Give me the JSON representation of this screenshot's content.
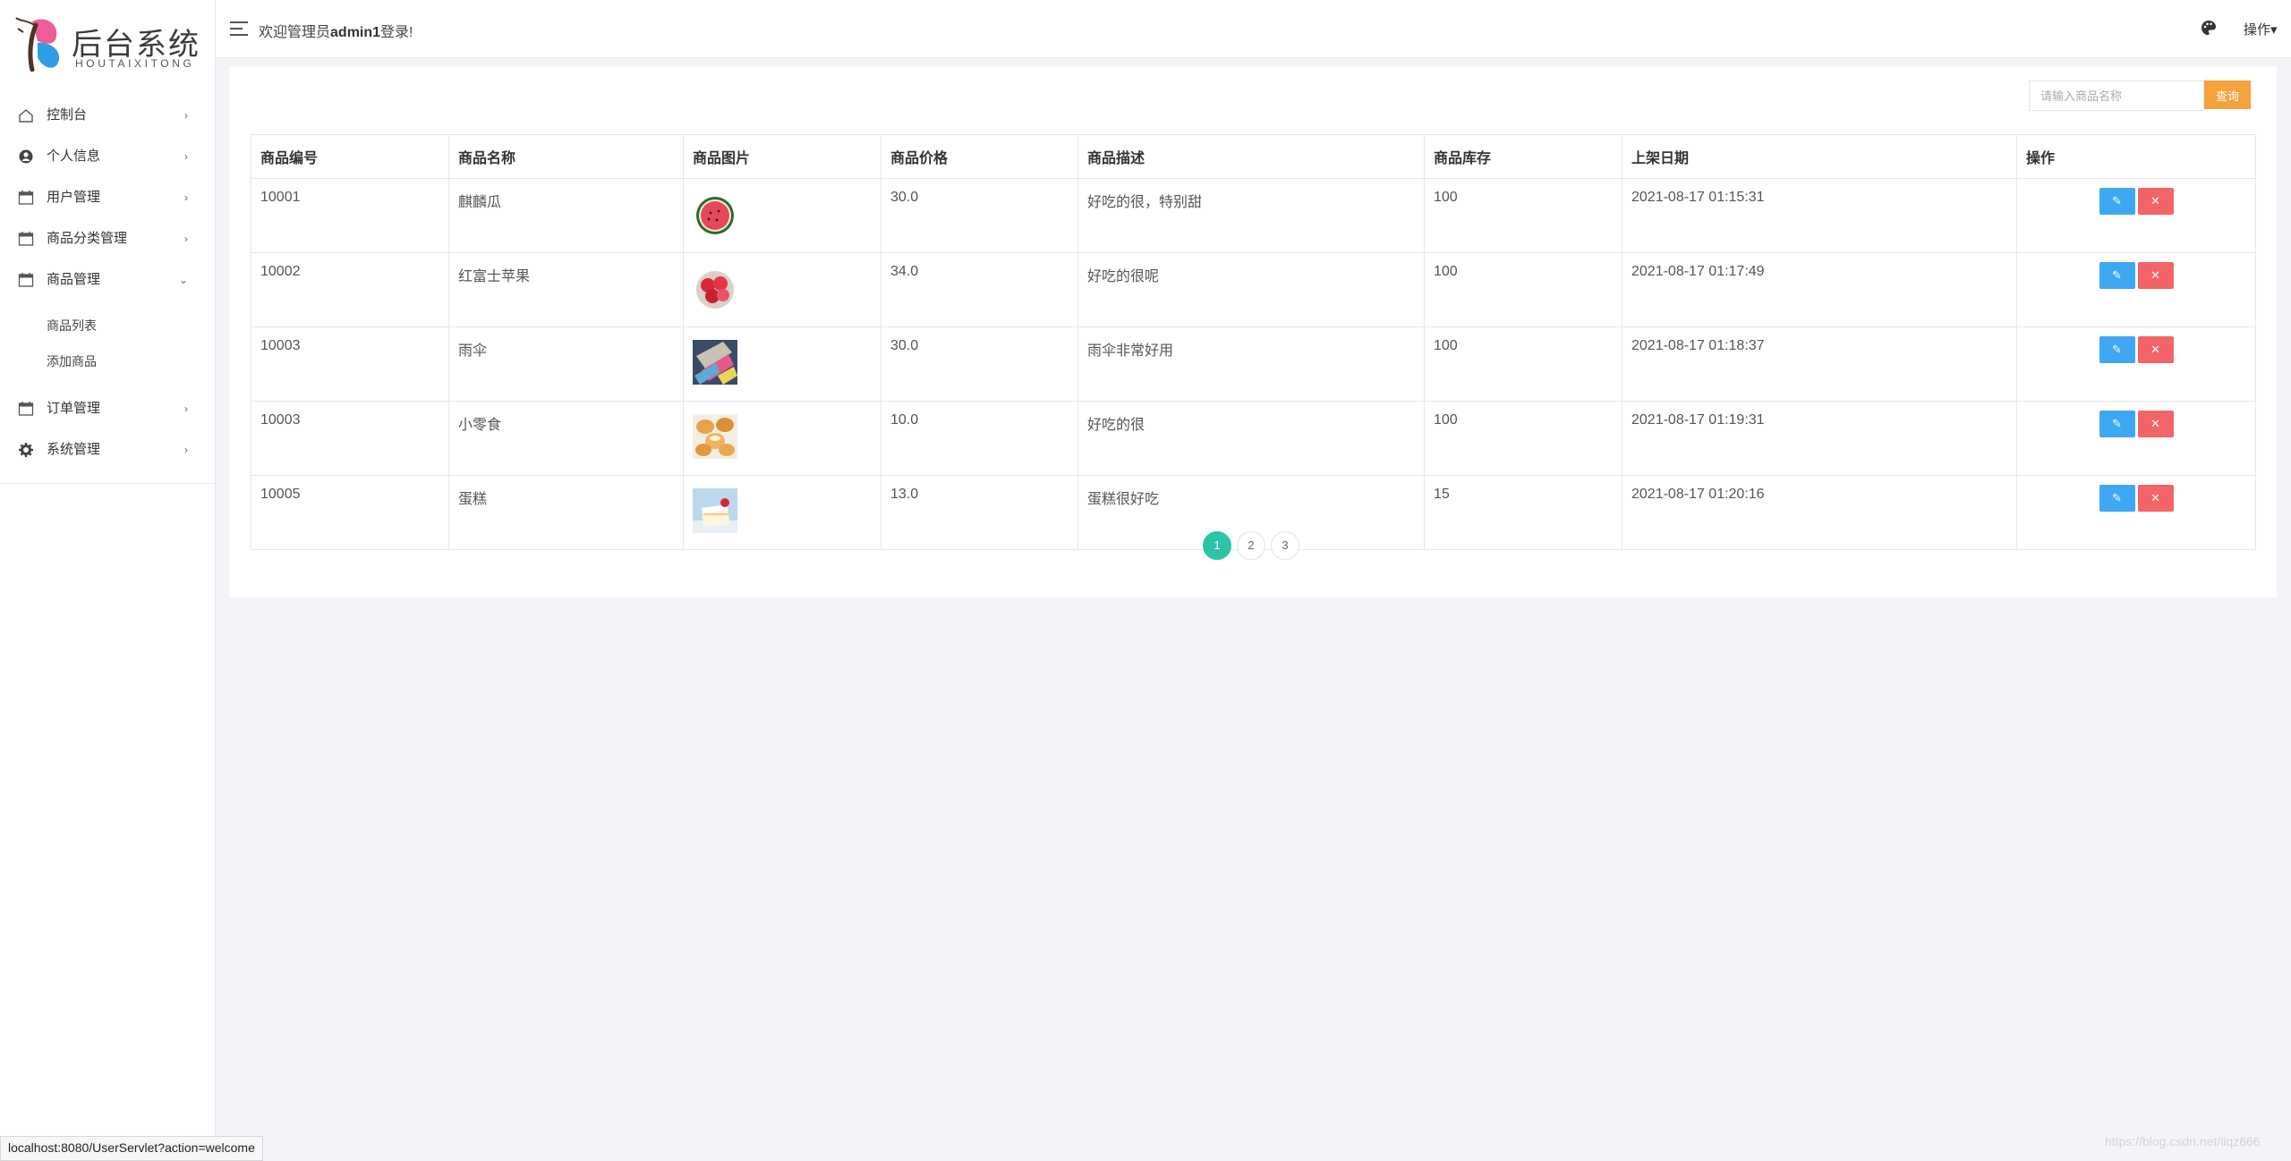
{
  "brand": {
    "title": "后台系统",
    "subtitle": "HOUTAIXITONG"
  },
  "sidebar": {
    "items": [
      {
        "label": "控制台",
        "icon": "home-icon",
        "arrow": "›"
      },
      {
        "label": "个人信息",
        "icon": "user-icon",
        "arrow": "›"
      },
      {
        "label": "用户管理",
        "icon": "calendar-icon",
        "arrow": "›"
      },
      {
        "label": "商品分类管理",
        "icon": "calendar-icon",
        "arrow": "›"
      },
      {
        "label": "商品管理",
        "icon": "calendar-icon",
        "arrow": "⌄",
        "expanded": true,
        "children": [
          {
            "label": "商品列表"
          },
          {
            "label": "添加商品"
          }
        ]
      },
      {
        "label": "订单管理",
        "icon": "calendar-icon",
        "arrow": "›"
      },
      {
        "label": "系统管理",
        "icon": "gear-icon",
        "arrow": "›"
      }
    ]
  },
  "header": {
    "welcome_prefix": "欢迎管理员",
    "username": "admin1",
    "welcome_suffix": "登录!",
    "ops_label": "操作▾"
  },
  "search": {
    "placeholder": "请输入商品名称",
    "button_label": "查询"
  },
  "table": {
    "columns": [
      "商品编号",
      "商品名称",
      "商品图片",
      "商品价格",
      "商品描述",
      "商品库存",
      "上架日期",
      "操作"
    ],
    "rows": [
      {
        "id": "10001",
        "name": "麒麟瓜",
        "image": "watermelon",
        "price": "30.0",
        "desc": "好吃的很，特别甜",
        "stock": "100",
        "date": "2021-08-17 01:15:31"
      },
      {
        "id": "10002",
        "name": "红富士苹果",
        "image": "apples",
        "price": "34.0",
        "desc": "好吃的很呢",
        "stock": "100",
        "date": "2021-08-17 01:17:49"
      },
      {
        "id": "10003",
        "name": "雨伞",
        "image": "umbrella",
        "price": "30.0",
        "desc": "雨伞非常好用",
        "stock": "100",
        "date": "2021-08-17 01:18:37"
      },
      {
        "id": "10003",
        "name": "小零食",
        "image": "snacks",
        "price": "10.0",
        "desc": "好吃的很",
        "stock": "100",
        "date": "2021-08-17 01:19:31"
      },
      {
        "id": "10005",
        "name": "蛋糕",
        "image": "cake",
        "price": "13.0",
        "desc": "蛋糕很好吃",
        "stock": "15",
        "date": "2021-08-17 01:20:16"
      }
    ],
    "edit_glyph": "✎",
    "delete_glyph": "✕"
  },
  "pagination": {
    "pages": [
      "1",
      "2",
      "3"
    ],
    "current": "1"
  },
  "statusbar": {
    "url": "localhost:8080/UserServlet?action=welcome"
  },
  "watermark": "https://blog.csdn.net/liqz666",
  "colors": {
    "accent": "#2dc3a7",
    "edit": "#3ea7f2",
    "delete": "#f26468",
    "search": "#f4a23c"
  }
}
